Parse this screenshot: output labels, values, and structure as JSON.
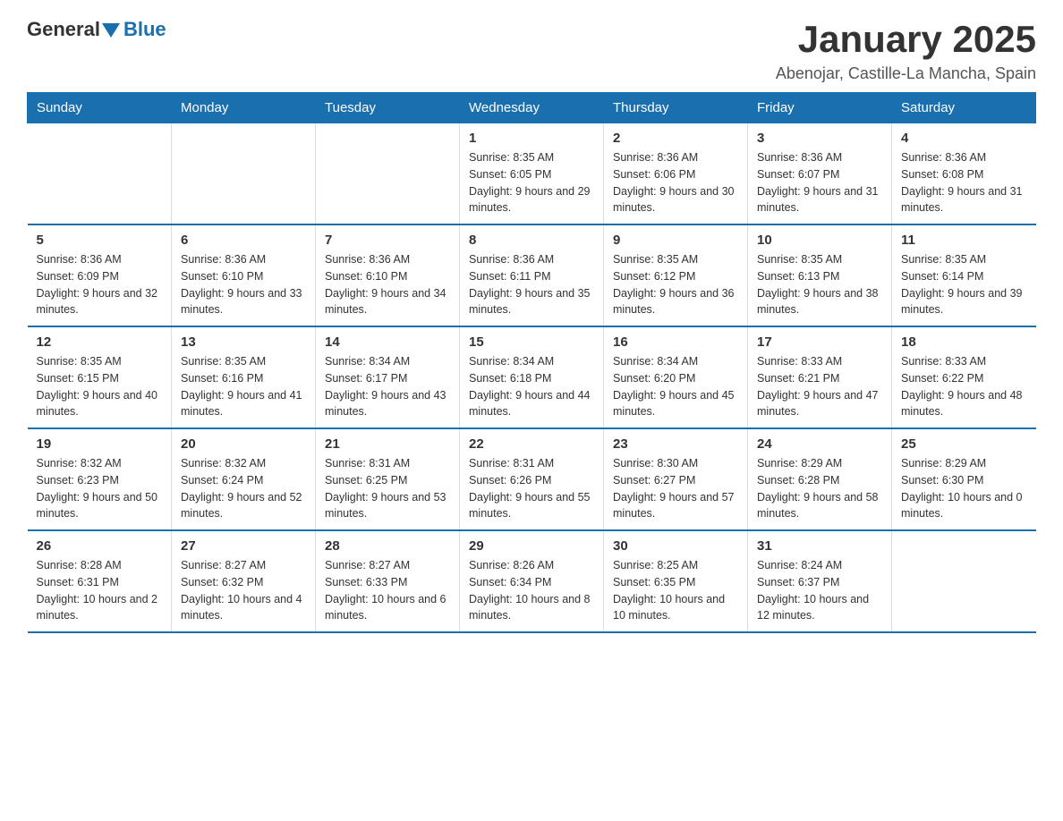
{
  "logo": {
    "general": "General",
    "blue": "Blue"
  },
  "title": "January 2025",
  "subtitle": "Abenojar, Castille-La Mancha, Spain",
  "weekdays": [
    "Sunday",
    "Monday",
    "Tuesday",
    "Wednesday",
    "Thursday",
    "Friday",
    "Saturday"
  ],
  "weeks": [
    [
      {
        "day": "",
        "info": ""
      },
      {
        "day": "",
        "info": ""
      },
      {
        "day": "",
        "info": ""
      },
      {
        "day": "1",
        "info": "Sunrise: 8:35 AM\nSunset: 6:05 PM\nDaylight: 9 hours and 29 minutes."
      },
      {
        "day": "2",
        "info": "Sunrise: 8:36 AM\nSunset: 6:06 PM\nDaylight: 9 hours and 30 minutes."
      },
      {
        "day": "3",
        "info": "Sunrise: 8:36 AM\nSunset: 6:07 PM\nDaylight: 9 hours and 31 minutes."
      },
      {
        "day": "4",
        "info": "Sunrise: 8:36 AM\nSunset: 6:08 PM\nDaylight: 9 hours and 31 minutes."
      }
    ],
    [
      {
        "day": "5",
        "info": "Sunrise: 8:36 AM\nSunset: 6:09 PM\nDaylight: 9 hours and 32 minutes."
      },
      {
        "day": "6",
        "info": "Sunrise: 8:36 AM\nSunset: 6:10 PM\nDaylight: 9 hours and 33 minutes."
      },
      {
        "day": "7",
        "info": "Sunrise: 8:36 AM\nSunset: 6:10 PM\nDaylight: 9 hours and 34 minutes."
      },
      {
        "day": "8",
        "info": "Sunrise: 8:36 AM\nSunset: 6:11 PM\nDaylight: 9 hours and 35 minutes."
      },
      {
        "day": "9",
        "info": "Sunrise: 8:35 AM\nSunset: 6:12 PM\nDaylight: 9 hours and 36 minutes."
      },
      {
        "day": "10",
        "info": "Sunrise: 8:35 AM\nSunset: 6:13 PM\nDaylight: 9 hours and 38 minutes."
      },
      {
        "day": "11",
        "info": "Sunrise: 8:35 AM\nSunset: 6:14 PM\nDaylight: 9 hours and 39 minutes."
      }
    ],
    [
      {
        "day": "12",
        "info": "Sunrise: 8:35 AM\nSunset: 6:15 PM\nDaylight: 9 hours and 40 minutes."
      },
      {
        "day": "13",
        "info": "Sunrise: 8:35 AM\nSunset: 6:16 PM\nDaylight: 9 hours and 41 minutes."
      },
      {
        "day": "14",
        "info": "Sunrise: 8:34 AM\nSunset: 6:17 PM\nDaylight: 9 hours and 43 minutes."
      },
      {
        "day": "15",
        "info": "Sunrise: 8:34 AM\nSunset: 6:18 PM\nDaylight: 9 hours and 44 minutes."
      },
      {
        "day": "16",
        "info": "Sunrise: 8:34 AM\nSunset: 6:20 PM\nDaylight: 9 hours and 45 minutes."
      },
      {
        "day": "17",
        "info": "Sunrise: 8:33 AM\nSunset: 6:21 PM\nDaylight: 9 hours and 47 minutes."
      },
      {
        "day": "18",
        "info": "Sunrise: 8:33 AM\nSunset: 6:22 PM\nDaylight: 9 hours and 48 minutes."
      }
    ],
    [
      {
        "day": "19",
        "info": "Sunrise: 8:32 AM\nSunset: 6:23 PM\nDaylight: 9 hours and 50 minutes."
      },
      {
        "day": "20",
        "info": "Sunrise: 8:32 AM\nSunset: 6:24 PM\nDaylight: 9 hours and 52 minutes."
      },
      {
        "day": "21",
        "info": "Sunrise: 8:31 AM\nSunset: 6:25 PM\nDaylight: 9 hours and 53 minutes."
      },
      {
        "day": "22",
        "info": "Sunrise: 8:31 AM\nSunset: 6:26 PM\nDaylight: 9 hours and 55 minutes."
      },
      {
        "day": "23",
        "info": "Sunrise: 8:30 AM\nSunset: 6:27 PM\nDaylight: 9 hours and 57 minutes."
      },
      {
        "day": "24",
        "info": "Sunrise: 8:29 AM\nSunset: 6:28 PM\nDaylight: 9 hours and 58 minutes."
      },
      {
        "day": "25",
        "info": "Sunrise: 8:29 AM\nSunset: 6:30 PM\nDaylight: 10 hours and 0 minutes."
      }
    ],
    [
      {
        "day": "26",
        "info": "Sunrise: 8:28 AM\nSunset: 6:31 PM\nDaylight: 10 hours and 2 minutes."
      },
      {
        "day": "27",
        "info": "Sunrise: 8:27 AM\nSunset: 6:32 PM\nDaylight: 10 hours and 4 minutes."
      },
      {
        "day": "28",
        "info": "Sunrise: 8:27 AM\nSunset: 6:33 PM\nDaylight: 10 hours and 6 minutes."
      },
      {
        "day": "29",
        "info": "Sunrise: 8:26 AM\nSunset: 6:34 PM\nDaylight: 10 hours and 8 minutes."
      },
      {
        "day": "30",
        "info": "Sunrise: 8:25 AM\nSunset: 6:35 PM\nDaylight: 10 hours and 10 minutes."
      },
      {
        "day": "31",
        "info": "Sunrise: 8:24 AM\nSunset: 6:37 PM\nDaylight: 10 hours and 12 minutes."
      },
      {
        "day": "",
        "info": ""
      }
    ]
  ]
}
